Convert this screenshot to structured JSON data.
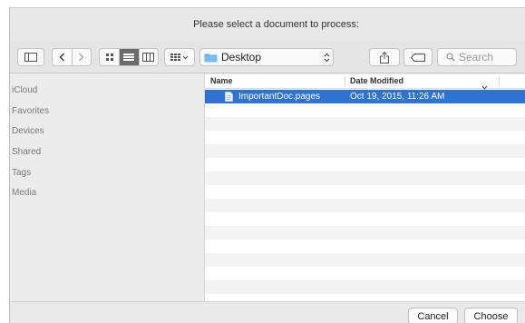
{
  "dialog": {
    "title": "Please select a document to process:"
  },
  "toolbar": {
    "location": "Desktop",
    "search_placeholder": "Search"
  },
  "sidebar": {
    "items": [
      {
        "label": "iCloud"
      },
      {
        "label": "Favorites"
      },
      {
        "label": "Devices"
      },
      {
        "label": "Shared"
      },
      {
        "label": "Tags"
      },
      {
        "label": "Media"
      }
    ]
  },
  "file_list": {
    "columns": [
      "Name",
      "Date Modified"
    ],
    "files": [
      {
        "name": "ImportantDoc.pages",
        "date_modified": "Oct 19, 2015, 11:26 AM",
        "selected": true
      }
    ]
  },
  "footer": {
    "cancel_label": "Cancel",
    "choose_label": "Choose"
  },
  "colors": {
    "selection": "#2f73d2",
    "folder": "#5aaef0",
    "window_bg": "#ececec"
  },
  "icons": [
    "sidebar-toggle-icon",
    "back-icon",
    "forward-icon",
    "icon-view-icon",
    "list-view-icon",
    "column-view-icon",
    "arrange-icon",
    "folder-icon",
    "up-down-chevron-icon",
    "share-icon",
    "tag-icon",
    "search-icon",
    "document-icon",
    "sort-chevron-icon"
  ]
}
